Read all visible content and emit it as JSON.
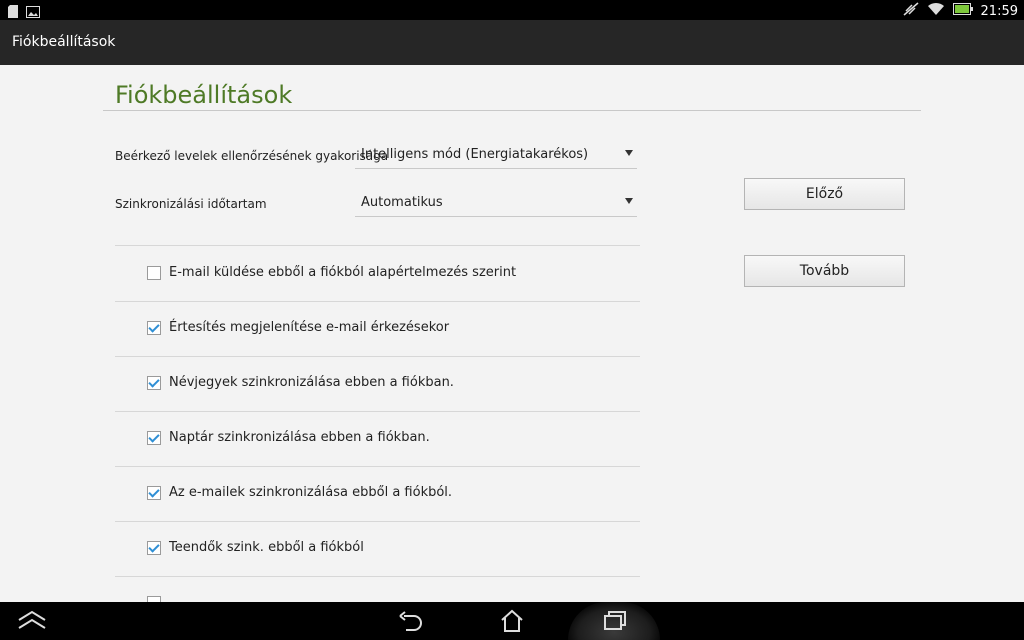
{
  "status_bar": {
    "time": "21:59",
    "left_icons": [
      "sd-card-icon",
      "image-icon"
    ],
    "right_icons": [
      "no-sync-icon",
      "wifi-icon",
      "battery-icon"
    ]
  },
  "title_bar": {
    "title": "Fiókbeállítások"
  },
  "page": {
    "heading": "Fiókbeállítások",
    "accent_color": "#4e7a26"
  },
  "settings": {
    "frequency": {
      "label": "Beérkező levelek ellenőrzésének gyakorisága",
      "value": "Intelligens mód (Energiatakarékos)"
    },
    "sync_period": {
      "label": "Szinkronizálási időtartam",
      "value": "Automatikus"
    }
  },
  "options": [
    {
      "label": "E-mail küldése ebből a fiókból alapértelmezés szerint",
      "checked": false
    },
    {
      "label": "Értesítés megjelenítése e-mail érkezésekor",
      "checked": true
    },
    {
      "label": "Névjegyek szinkronizálása ebben a fiókban.",
      "checked": true
    },
    {
      "label": "Naptár szinkronizálása ebben a fiókban.",
      "checked": true
    },
    {
      "label": "Az e-mailek szinkronizálása ebből a fiókból.",
      "checked": true
    },
    {
      "label": "Teendők szink. ebből a fiókból",
      "checked": true
    }
  ],
  "buttons": {
    "previous": "Előző",
    "next": "Tovább"
  },
  "nav_bar": {
    "icons": [
      "keyboard-hide-icon",
      "back-icon",
      "home-icon",
      "recent-apps-icon"
    ]
  }
}
